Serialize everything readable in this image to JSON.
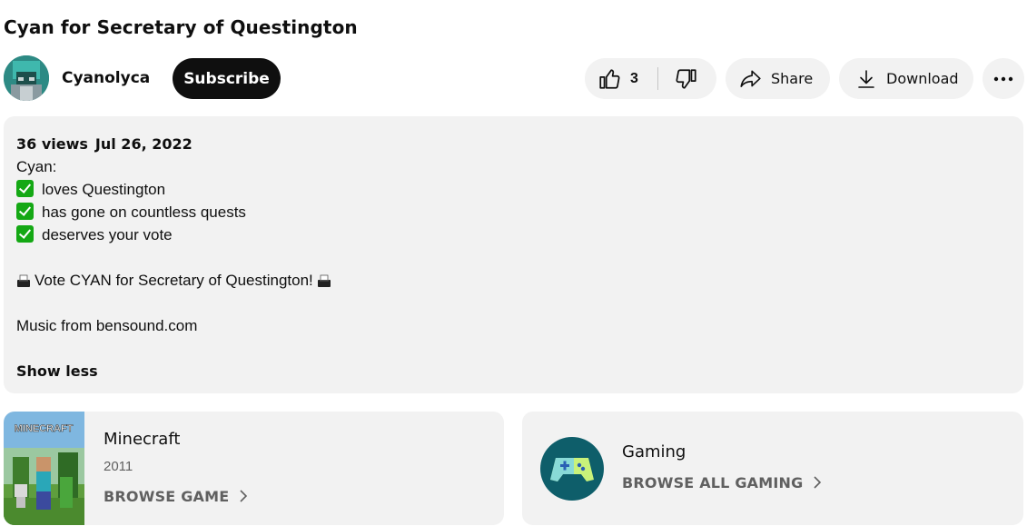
{
  "video": {
    "title": "Cyan for Secretary of Questington"
  },
  "channel": {
    "name": "Cyanolyca",
    "subscribe_label": "Subscribe"
  },
  "actions": {
    "like_count": "3",
    "share_label": "Share",
    "download_label": "Download"
  },
  "description": {
    "views": "36 views",
    "date": "Jul 26, 2022",
    "lines": [
      "Cyan:",
      "loves Questington",
      "has gone on countless quests",
      "deserves your vote",
      "Vote CYAN for Secretary of Questington!",
      "Music from bensound.com"
    ],
    "show_less_label": "Show less"
  },
  "game_card": {
    "title": "Minecraft",
    "thumbnail_text": "MINECRAFT",
    "year": "2011",
    "browse_label": "BROWSE GAME"
  },
  "gaming_card": {
    "title": "Gaming",
    "browse_label": "BROWSE ALL GAMING"
  },
  "colors": {
    "subscribe_bg": "#0f0f0f",
    "pill_bg": "#f2f2f2",
    "check_green": "#14a814",
    "gaming_icon_bg": "#0e5e6a"
  },
  "icons": [
    "thumbs-up-icon",
    "thumbs-down-icon",
    "share-arrow-icon",
    "download-icon",
    "more-dots-icon",
    "check-icon",
    "ballot-box-icon",
    "chevron-right-icon",
    "game-controller-icon"
  ]
}
